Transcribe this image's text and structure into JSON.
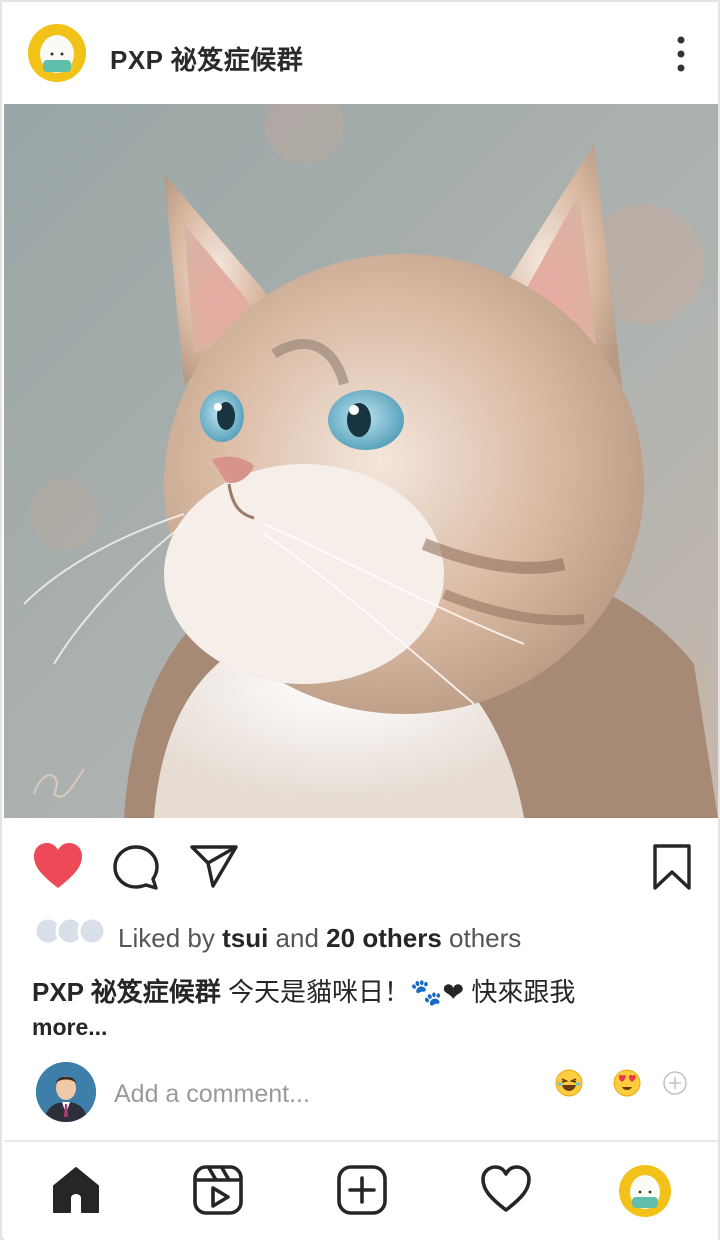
{
  "post": {
    "username": "PXP 祕笈症候群",
    "caption_user": "PXP 祕笈症候群",
    "caption_text": "今天是貓咪日！🐾❤ 快來跟我",
    "more_label": "more..."
  },
  "likes": {
    "prefix": "Liked by",
    "user": "tsui",
    "and": "and",
    "others_bold": "20 others",
    "others_trailing": "others"
  },
  "comment": {
    "placeholder": "Add a comment..."
  },
  "colors": {
    "heart": "#ed4956",
    "logo_yellow": "#f2c219",
    "text": "#262626"
  },
  "icons": {
    "post_menu": "more-vertical-icon",
    "like": "heart-filled-icon",
    "comment": "comment-bubble-icon",
    "share": "paper-plane-icon",
    "save": "bookmark-icon",
    "emoji_1": "laughing-emoji-icon",
    "emoji_2": "heart-eyes-emoji-icon",
    "emoji_add": "add-circle-icon",
    "nav_home": "home-icon",
    "nav_reels": "reels-icon",
    "nav_create": "create-post-icon",
    "nav_activity": "heart-outline-icon",
    "nav_profile": "profile-avatar-icon"
  }
}
